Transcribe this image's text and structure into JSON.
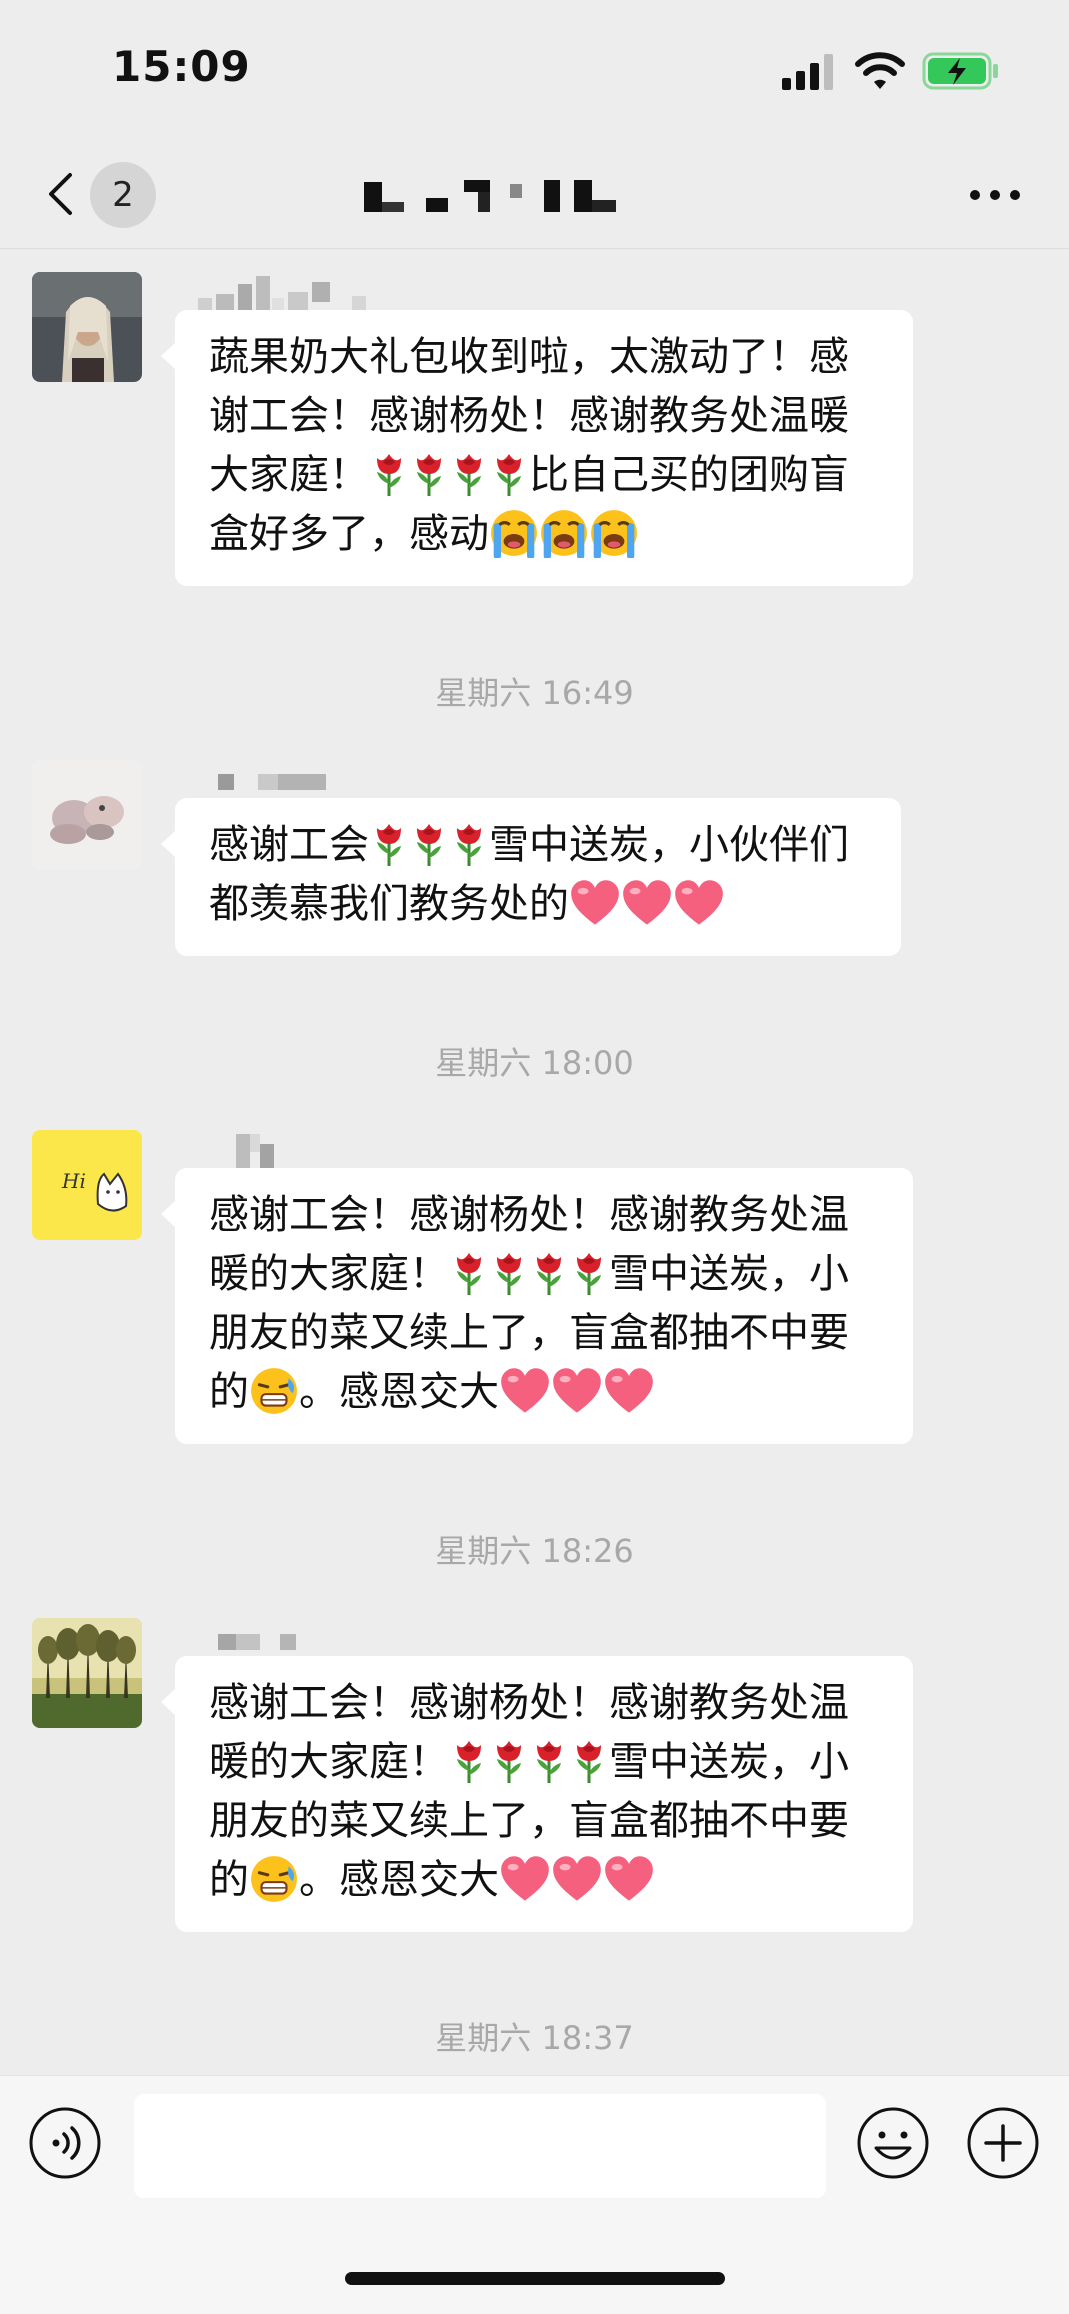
{
  "status_bar": {
    "time": "15:09"
  },
  "nav": {
    "unread_count": "2"
  },
  "messages": [
    {
      "text": "蔬果奶大礼包收到啦，太激动了！感谢工会！感谢杨处！感谢教务处温暖大家庭！"
    },
    {
      "text_tail": "比自己买的团购盲盒好多了，感动"
    },
    {
      "text": "感谢工会"
    },
    {
      "text_tail": "雪中送炭，小伙伴们都羡慕我们教务处的"
    },
    {
      "text": "感谢工会！感谢杨处！感谢教务处温暖的大家庭！"
    },
    {
      "text_tail": "雪中送炭，小朋友的菜又续上了，盲盒都抽不中要的"
    },
    {
      "text_end": "。感恩交大"
    },
    {
      "text": "感谢工会！感谢杨处！感谢教务处温暖的大家庭！"
    },
    {
      "text_tail": "雪中送炭，小朋友的菜又续上了，盲盒都抽不中要的"
    },
    {
      "text_end": "。感恩交大"
    }
  ],
  "timestamps": [
    "星期六 16:49",
    "星期六 18:00",
    "星期六 18:26",
    "星期六 18:37"
  ],
  "icons": {
    "rose": "rose-icon",
    "cry": "loudly-crying-face-icon",
    "heart": "pink-heart-icon",
    "grimace": "tearful-face-icon"
  },
  "colors": {
    "background": "#ededed",
    "bubble": "#ffffff",
    "battery": "#34c759",
    "timestamp": "#a8a8a8"
  }
}
